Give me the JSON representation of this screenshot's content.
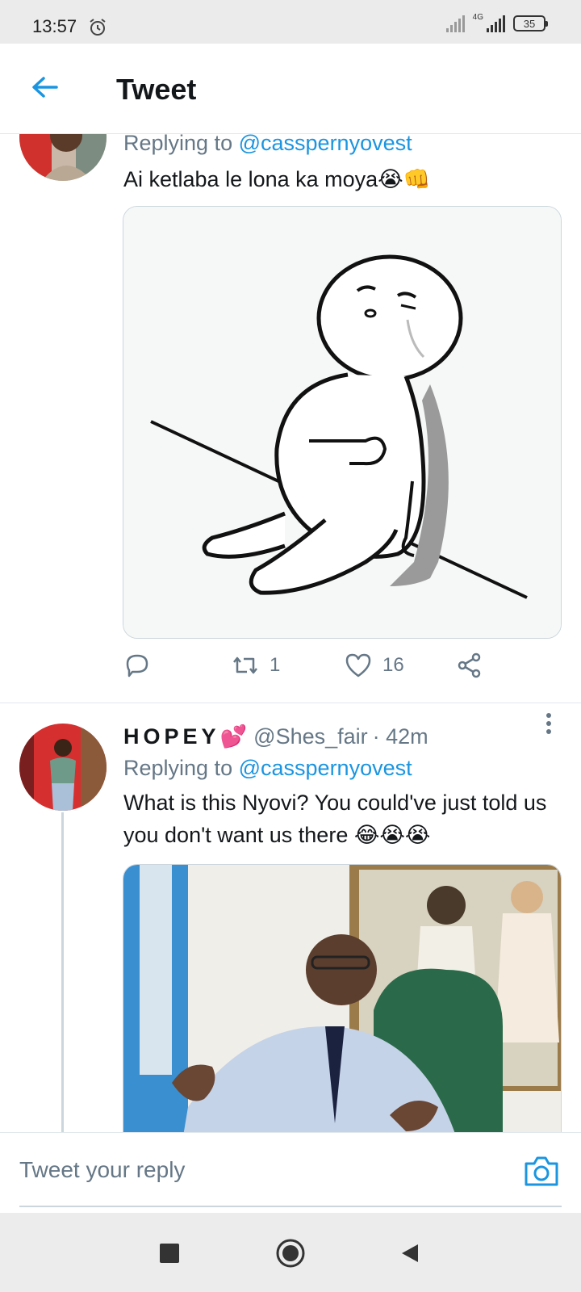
{
  "status": {
    "time": "13:57",
    "network": "4G",
    "battery": "35"
  },
  "header": {
    "title": "Tweet"
  },
  "tweet1": {
    "reply_prefix": "Replying to",
    "reply_to": "@casspernyovest",
    "text": "Ai ketlaba le lona ka moya😭👊",
    "retweets": "1",
    "likes": "16"
  },
  "tweet2": {
    "display_name": "HOPEY",
    "name_emoji": "💕",
    "handle": "@Shes_fair",
    "time": "· 42m",
    "reply_prefix": "Replying to",
    "reply_to": "@casspernyovest",
    "text": "What is this Nyovi? You could've just told us you don't want us there 😂😭😭"
  },
  "reply_box": {
    "placeholder": "Tweet your reply"
  },
  "colors": {
    "accent": "#1b95e0",
    "secondary_text": "#657786",
    "border": "#e1e8ed"
  },
  "icons": [
    "alarm-icon",
    "back-arrow-icon",
    "reply-icon",
    "retweet-icon",
    "like-icon",
    "share-icon",
    "more-icon",
    "camera-icon",
    "nav-recents-icon",
    "nav-home-icon",
    "nav-back-icon"
  ]
}
